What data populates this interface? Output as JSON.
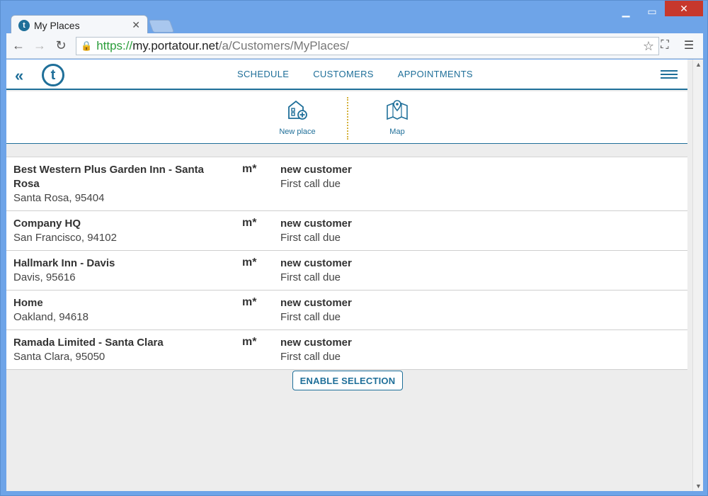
{
  "browser": {
    "tab_title": "My Places",
    "favicon_letter": "t",
    "url_scheme": "https://",
    "url_host": "my.portatour.net",
    "url_path": "/a/Customers/MyPlaces/"
  },
  "appnav": {
    "logo_letter": "t",
    "links": [
      "SCHEDULE",
      "CUSTOMERS",
      "APPOINTMENTS"
    ]
  },
  "actions": {
    "new_place_label": "New place",
    "map_label": "Map"
  },
  "places": [
    {
      "name": "Best Western Plus Garden Inn - Santa Rosa",
      "address": "Santa Rosa, 95404",
      "code": "m*",
      "status": "new customer",
      "note": "First call due"
    },
    {
      "name": "Company HQ",
      "address": "San Francisco, 94102",
      "code": "m*",
      "status": "new customer",
      "note": "First call due"
    },
    {
      "name": "Hallmark Inn - Davis",
      "address": "Davis, 95616",
      "code": "m*",
      "status": "new customer",
      "note": "First call due"
    },
    {
      "name": "Home",
      "address": "Oakland, 94618",
      "code": "m*",
      "status": "new customer",
      "note": "First call due"
    },
    {
      "name": "Ramada Limited - Santa Clara",
      "address": "Santa Clara, 95050",
      "code": "m*",
      "status": "new customer",
      "note": "First call due"
    }
  ],
  "enable_selection_label": "ENABLE SELECTION",
  "colors": {
    "accent": "#1f6f99",
    "divider": "#d4b13a"
  }
}
